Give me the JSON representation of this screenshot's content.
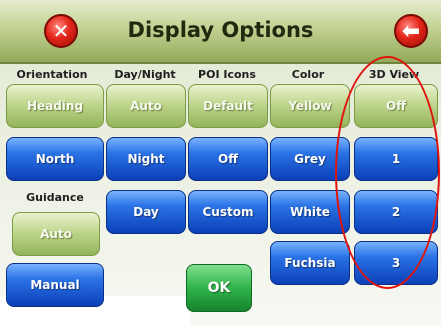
{
  "title": "Display Options",
  "close_icon_glyph": "✕",
  "back_icon_glyph": "⬅",
  "columns": {
    "orientation": "Orientation",
    "day_night": "Day/Night",
    "poi_icons": "POI Icons",
    "color": "Color",
    "view_3d": "3D View"
  },
  "guidance_label": "Guidance",
  "orientation_options": [
    "Heading",
    "North"
  ],
  "day_night_options": [
    "Auto",
    "Night",
    "Day"
  ],
  "poi_options": [
    "Default",
    "Off",
    "Custom"
  ],
  "color_options": [
    "Yellow",
    "Grey",
    "White",
    "Fuchsia"
  ],
  "view_3d_options": [
    "Off",
    "1",
    "2",
    "3"
  ],
  "guidance_options": [
    "Auto",
    "Manual"
  ],
  "ok_label": "OK",
  "colors": {
    "selected": "#a9c472",
    "unselected": "#1f5ad4",
    "ok": "#2fb34a",
    "highlight": "#e0140f"
  }
}
